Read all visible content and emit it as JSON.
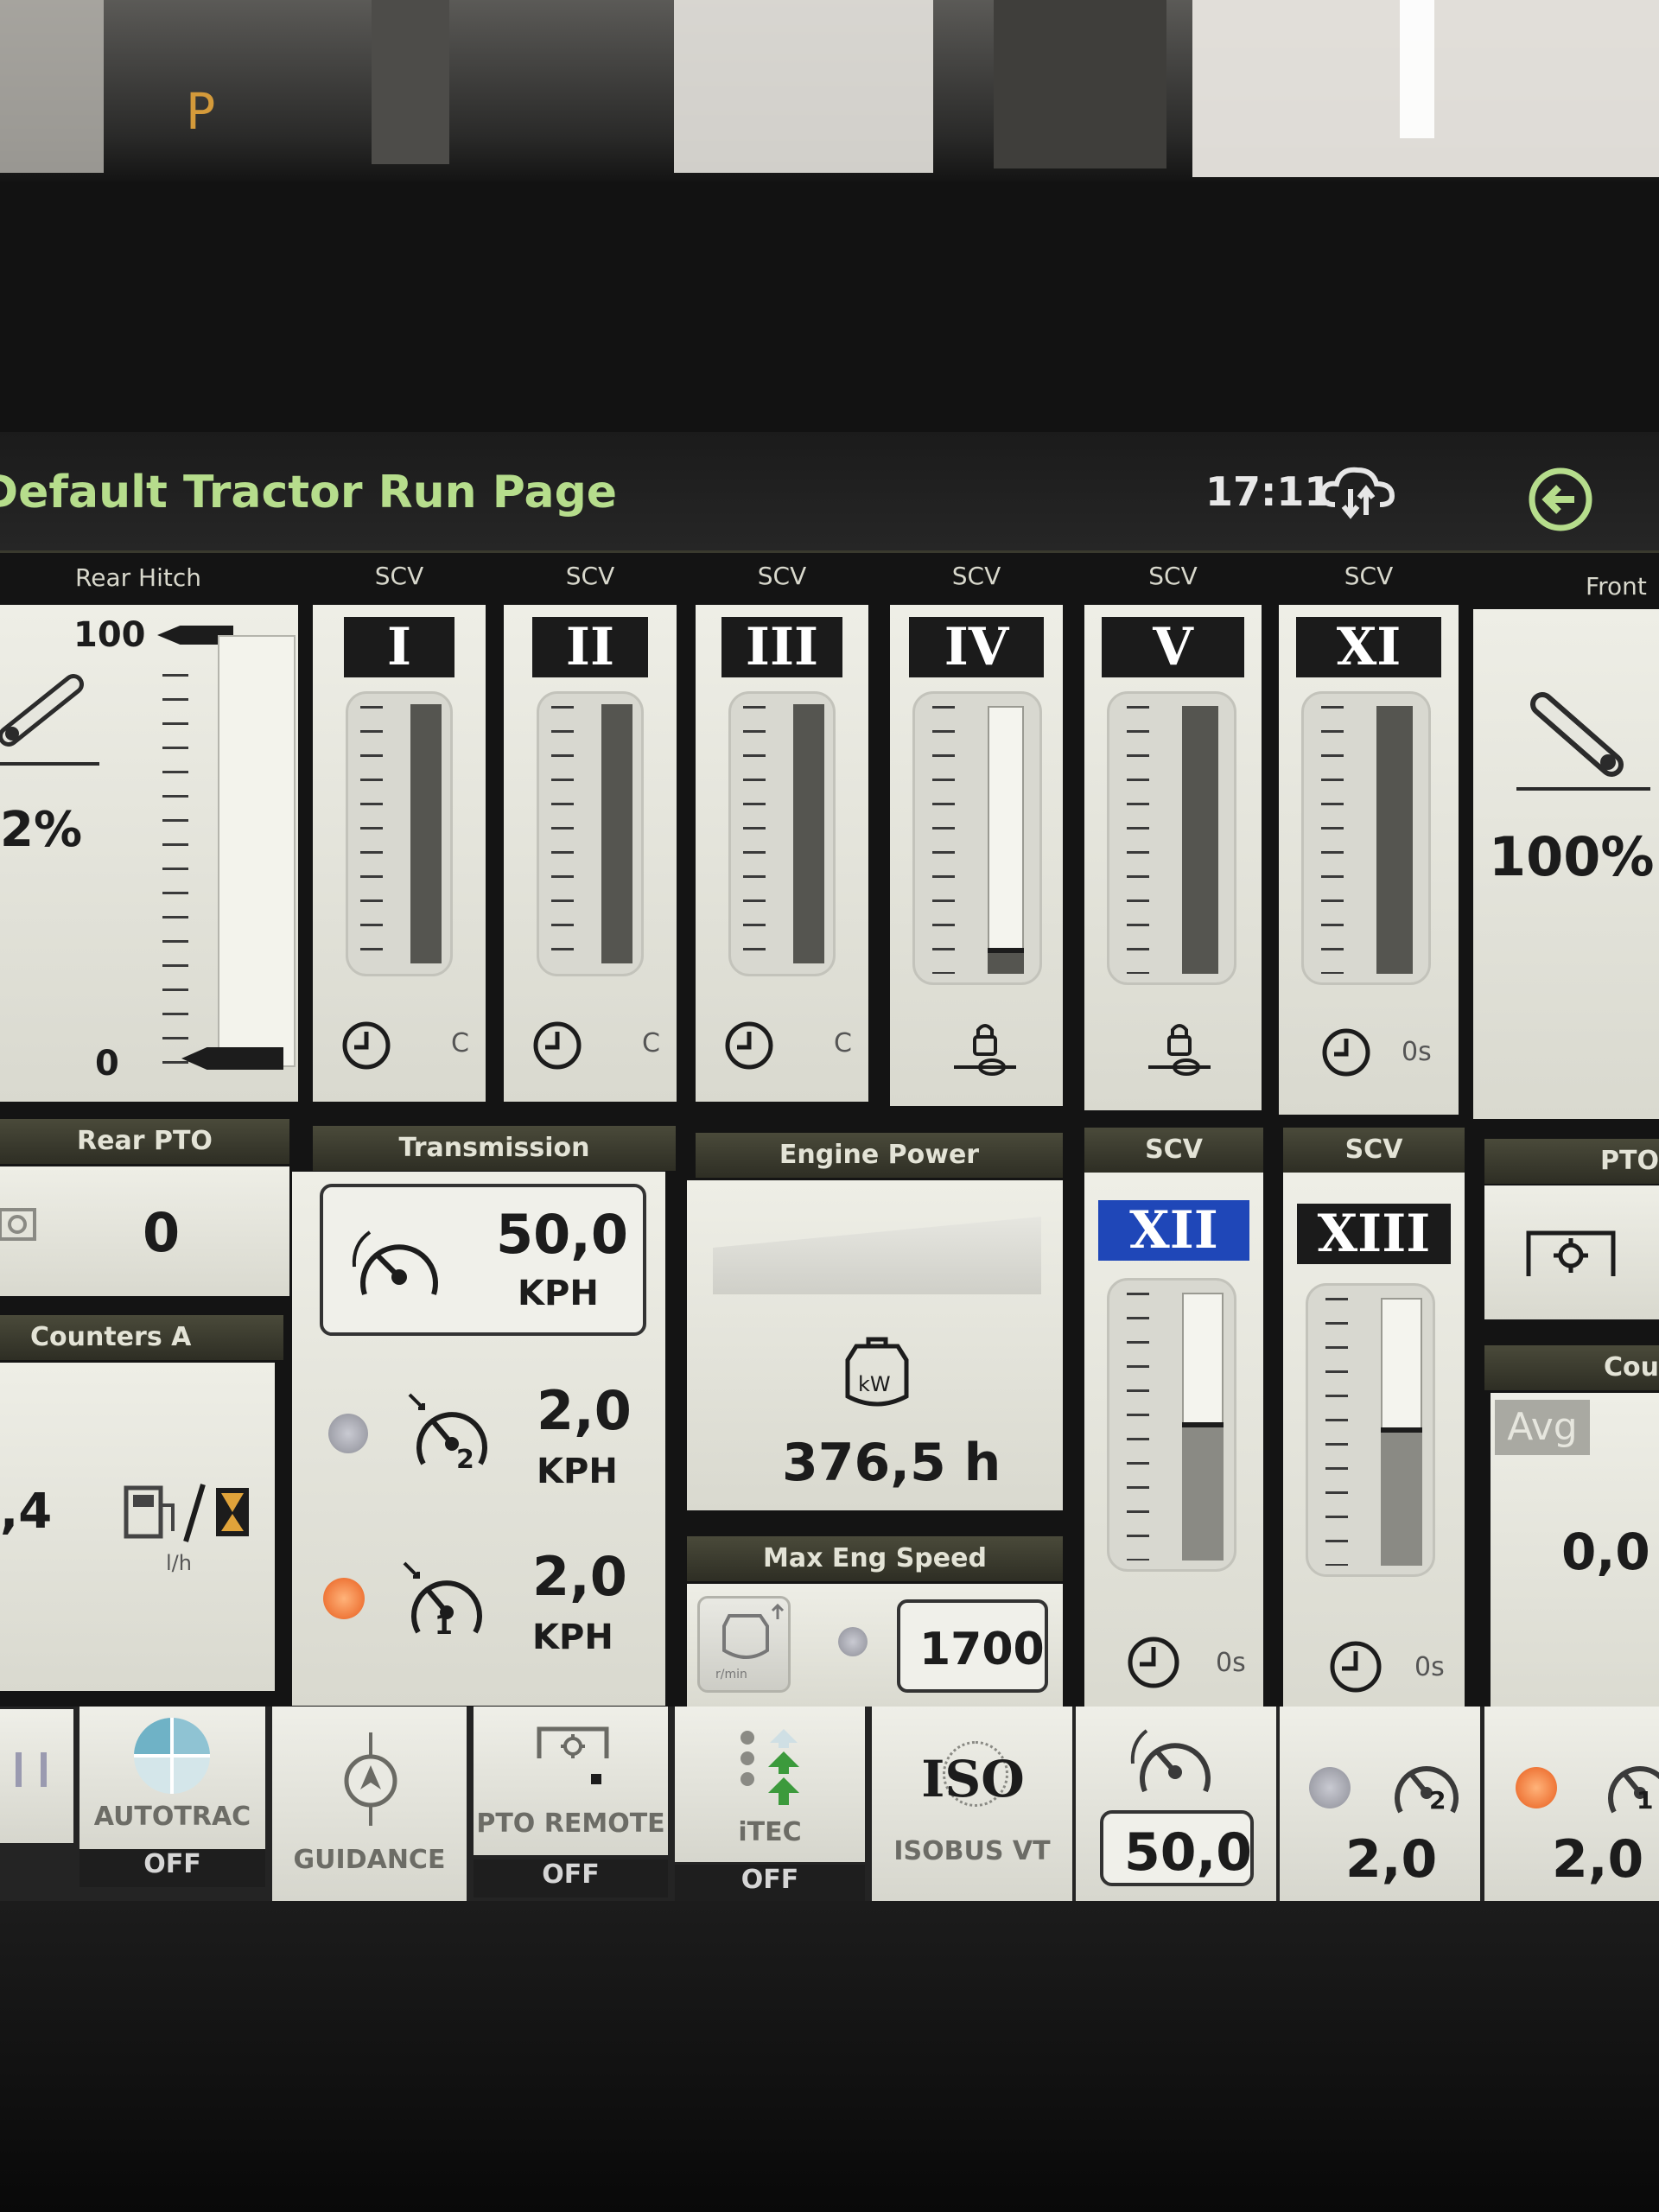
{
  "background": {
    "led_letter": "P"
  },
  "header": {
    "title": "Default Tractor Run Page",
    "time": "17:11",
    "cloud_icon": "cloud-sync-icon",
    "back_icon": "back-arrow-icon"
  },
  "rear_hitch": {
    "label": "Rear Hitch",
    "top_mark": "100",
    "bottom_mark": "0",
    "percent": "2%",
    "position_fraction": 0.02
  },
  "scv_top": [
    {
      "label": "SCV",
      "roman": "I",
      "mode": "C",
      "fill": 1.0,
      "icon": "clock-icon"
    },
    {
      "label": "SCV",
      "roman": "II",
      "mode": "C",
      "fill": 1.0,
      "icon": "clock-icon"
    },
    {
      "label": "SCV",
      "roman": "III",
      "mode": "C",
      "fill": 1.0,
      "icon": "clock-icon"
    },
    {
      "label": "SCV",
      "roman": "IV",
      "mode": "",
      "fill": 0.08,
      "icon": "lock-icon"
    },
    {
      "label": "SCV",
      "roman": "V",
      "mode": "",
      "fill": 1.0,
      "icon": "lock-icon"
    },
    {
      "label": "SCV",
      "roman": "XI",
      "mode": "0s",
      "fill": 1.0,
      "icon": "clock-icon"
    }
  ],
  "front_hitch": {
    "label": "Front",
    "percent": "100%",
    "position_fraction": 1.0
  },
  "rear_pto": {
    "label": "Rear PTO",
    "value": "0"
  },
  "counters_a": {
    "label": "Counters A",
    "value": ",4",
    "unit": "l/h"
  },
  "transmission": {
    "label": "Transmission",
    "main": {
      "value": "50,0",
      "unit": "KPH"
    },
    "preset2": {
      "value": "2,0",
      "unit": "KPH",
      "badge": "2"
    },
    "preset1": {
      "value": "2,0",
      "unit": "KPH",
      "badge": "1"
    }
  },
  "engine_power": {
    "label": "Engine Power",
    "icon_text": "kW",
    "hours": "376,5 h"
  },
  "max_eng_speed": {
    "label": "Max Eng Speed",
    "value": "1700",
    "icon_text": "r/min"
  },
  "scv_bottom": [
    {
      "label": "SCV",
      "roman": "XII",
      "selected": true,
      "mode": "0s",
      "fill": 0.5
    },
    {
      "label": "SCV",
      "roman": "XIII",
      "selected": false,
      "mode": "0s",
      "fill": 0.5
    }
  ],
  "right_partial": {
    "pto_label": "PTO",
    "counters_label": "Cou",
    "avg_label": "Avg",
    "value": "0,0"
  },
  "bottom_bar": {
    "autotrac": {
      "label": "AUTOTRAC",
      "status": "OFF"
    },
    "guidance": {
      "label": "GUIDANCE"
    },
    "pto_remote": {
      "label": "PTO REMOTE",
      "status": "OFF"
    },
    "itec": {
      "label": "iTEC",
      "status": "OFF"
    },
    "isobus": {
      "logo": "ISO",
      "label": "ISOBUS VT"
    },
    "speed": {
      "value": "50,0"
    },
    "preset2": {
      "value": "2,0",
      "badge": "2"
    },
    "preset1": {
      "value": "2,0",
      "badge": "1"
    }
  }
}
